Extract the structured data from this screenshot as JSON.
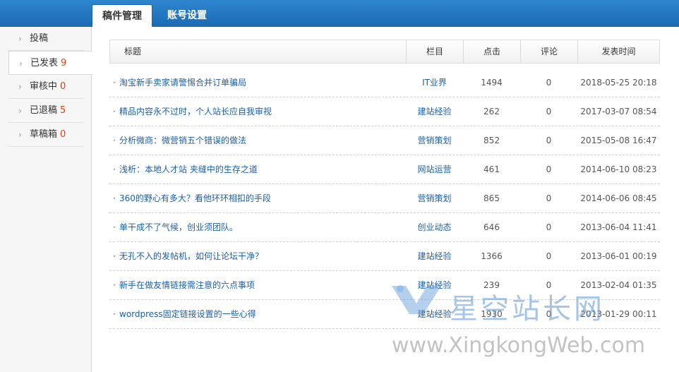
{
  "tabs": [
    {
      "label": "稿件管理",
      "active": true
    },
    {
      "label": "账号设置",
      "active": false
    }
  ],
  "sidebar": {
    "items": [
      {
        "label": "投稿",
        "count": ""
      },
      {
        "label": "已发表",
        "count": "9"
      },
      {
        "label": "审核中",
        "count": "0"
      },
      {
        "label": "已退稿",
        "count": "5"
      },
      {
        "label": "草稿箱",
        "count": "0"
      }
    ],
    "active_index": 1
  },
  "table": {
    "headers": {
      "title": "标题",
      "column": "栏目",
      "clicks": "点击",
      "comments": "评论",
      "time": "发表时间"
    },
    "rows": [
      {
        "title": "淘宝新手卖家请警惕合并订单骗局",
        "column": "IT业界",
        "clicks": "1494",
        "comments": "0",
        "time": "2018-05-25 20:18"
      },
      {
        "title": "精品内容永不过时，个人站长应自我审视",
        "column": "建站经验",
        "clicks": "262",
        "comments": "0",
        "time": "2017-03-07 08:54"
      },
      {
        "title": "分析微商：微营销五个错误的做法",
        "column": "营销策划",
        "clicks": "852",
        "comments": "0",
        "time": "2015-05-08 16:47"
      },
      {
        "title": "浅析：本地人才站 夹缝中的生存之道",
        "column": "网站运营",
        "clicks": "461",
        "comments": "0",
        "time": "2014-06-10 08:23"
      },
      {
        "title": "360的野心有多大？看他环环相扣的手段",
        "column": "营销策划",
        "clicks": "865",
        "comments": "0",
        "time": "2014-06-06 08:45"
      },
      {
        "title": "单干成不了气候，创业须团队。",
        "column": "创业动态",
        "clicks": "646",
        "comments": "0",
        "time": "2013-06-04 11:41"
      },
      {
        "title": "无孔不入的发帖机，如何让论坛干净？",
        "column": "建站经验",
        "clicks": "1366",
        "comments": "0",
        "time": "2013-06-01 00:19"
      },
      {
        "title": "新手在做友情链接需注意的六点事项",
        "column": "建站经验",
        "clicks": "239",
        "comments": "0",
        "time": "2013-02-04 01:35"
      },
      {
        "title": "wordpress固定链接设置的一些心得",
        "column": "建站经验",
        "clicks": "1930",
        "comments": "0",
        "time": "2013-01-29 00:11"
      }
    ]
  },
  "watermark": {
    "cn": "星空站长网",
    "en": "www.XingkongWeb.com"
  },
  "colors": {
    "tab_bar": "#1b6bb5",
    "link": "#1a5fa8",
    "count": "#d9400f"
  }
}
